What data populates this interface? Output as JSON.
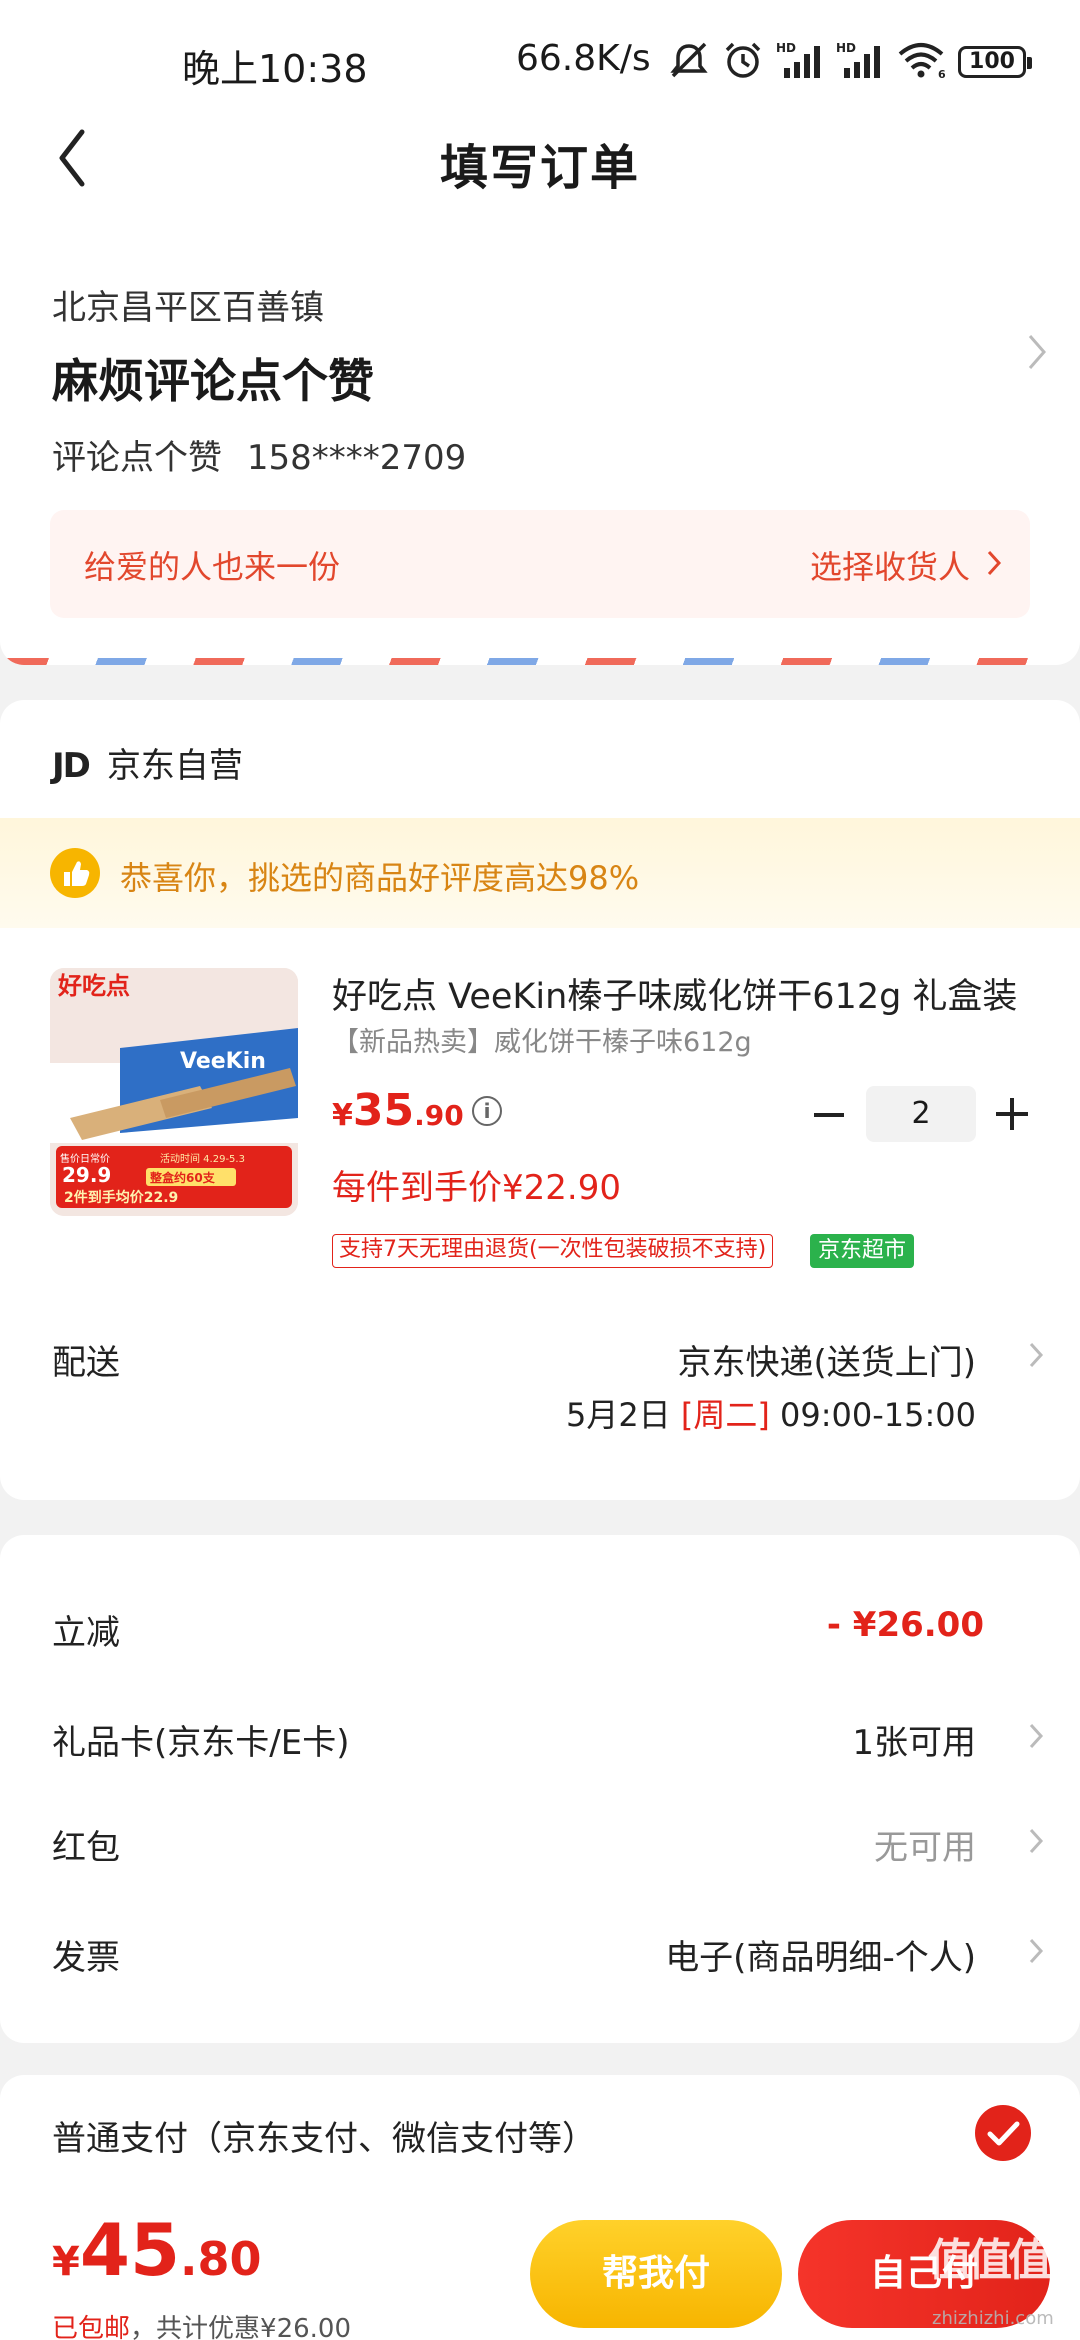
{
  "status_bar": {
    "time": "晚上10:38",
    "net_speed": "66.8K/s",
    "battery": "100",
    "icons": [
      "mute-icon",
      "alarm-icon",
      "signal-hd-icon",
      "signal-hd-icon",
      "wifi-icon",
      "battery-icon"
    ]
  },
  "nav": {
    "back_icon": "chevron-left-icon",
    "title": "填写订单"
  },
  "address": {
    "region": "北京昌平区百善镇",
    "detail": "麻烦评论点个赞",
    "contact_name": "评论点个赞",
    "phone": "158****2709",
    "gift_text": "给爱的人也来一份",
    "choose_receiver": "选择收货人"
  },
  "store": {
    "logo": "JD",
    "name": "京东自营",
    "praise": "恭喜你，挑选的商品好评度高达98%"
  },
  "product": {
    "title": "好吃点 VeeKin榛子味威化饼干612g 礼盒装",
    "subtitle": "【新品热卖】威化饼干榛子味612g",
    "price_symbol": "¥",
    "price_int": "35",
    "price_dec": ".90",
    "quantity": "2",
    "unit_price": "每件到手价¥22.90",
    "tag_return": "支持7天无理由退货(一次性包装破损不支持)",
    "tag_market": "京东超市",
    "img_brand": "好吃点",
    "img_product": "VeeKin",
    "img_promo1": "29.9",
    "img_promo2": "整盒约60支",
    "img_promo3": "2件到手均价22.9",
    "img_promo_top": "售价日常价",
    "img_promo_date": "活动时间 4.29-5.3"
  },
  "shipping": {
    "label": "配送",
    "method": "京东快递(送货上门)",
    "date": "5月2日",
    "weekday": "[周二]",
    "window": "09:00-15:00"
  },
  "fees": [
    {
      "label": "立减",
      "value": "- ¥26.00",
      "style": "red",
      "arrow": false
    },
    {
      "label": "礼品卡(京东卡/E卡)",
      "value": "1张可用",
      "style": "normal",
      "arrow": true
    },
    {
      "label": "红包",
      "value": "无可用",
      "style": "gray",
      "arrow": true
    },
    {
      "label": "发票",
      "value": "电子(商品明细-个人)",
      "style": "normal",
      "arrow": true
    }
  ],
  "payment": {
    "label": "普通支付（京东支付、微信支付等）"
  },
  "bottom": {
    "sym": "¥",
    "total_int": "45",
    "total_dec": ".80",
    "free_ship": "已包邮",
    "discount_note": "，共计优惠",
    "discount_value": "¥26.00",
    "help_pay": "帮我付",
    "self_pay": "自己付",
    "watermark": "值值值",
    "watermark_site": "zhizhizhi.com"
  },
  "colors": {
    "accent_red": "#e2231a",
    "accent_yellow": "#f7b500",
    "market_green": "#2bb24c"
  }
}
